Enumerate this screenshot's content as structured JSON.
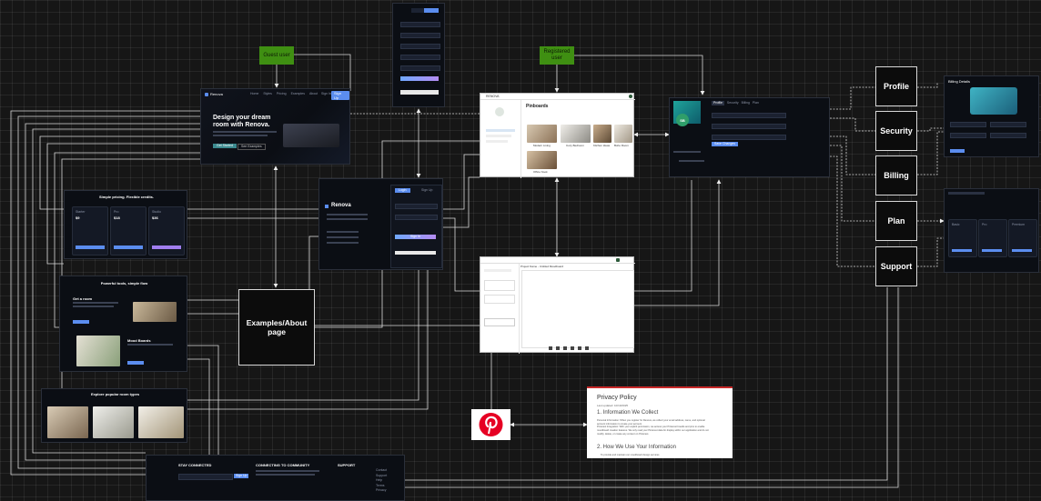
{
  "labels": {
    "guest_user": "Guest user",
    "registered_user": "Registered user",
    "examples_about": "Examples/About page",
    "profile": "Profile",
    "security": "Security",
    "billing": "Billing",
    "plan": "Plan",
    "support": "Support"
  },
  "landing": {
    "brand": "Renova",
    "nav": [
      "Home",
      "Styles",
      "Pricing",
      "Examples",
      "About"
    ],
    "signin": "Sign In",
    "signup": "Sign Up",
    "hero_line1": "Design your dream",
    "hero_line2": "room with Renova.",
    "cta_primary": "Get Started",
    "cta_secondary": "See Examples"
  },
  "auth": {
    "brand": "Renova",
    "tab_login": "Login",
    "tab_signup": "Sign Up",
    "submit": "Sign In"
  },
  "pricing": {
    "title": "Simple pricing. Flexible credits.",
    "plans": [
      {
        "name": "Starter",
        "price": "$9"
      },
      {
        "name": "Pro",
        "price": "$18"
      },
      {
        "name": "Studio",
        "price": "$36"
      }
    ]
  },
  "features": {
    "title": "Powerful tools, simple flow",
    "block1": "Get a room",
    "block2": "Mood Boards"
  },
  "explore": {
    "title": "Explore popular room types"
  },
  "footer": {
    "col1": "STAY CONNECTED",
    "col2": "CONNECTING TO COMMUNITY",
    "col3": "SUPPORT",
    "subscribe": "Sign Up",
    "links": [
      "Contact",
      "Support",
      "Help",
      "Terms",
      "Privacy"
    ]
  },
  "dashboard": {
    "brand": "RENOVA",
    "heading": "Pinboards",
    "items": [
      "Modern Living",
      "Cozy Bedroom",
      "Kitchen Ideas",
      "Boho Room",
      "Office Nook"
    ]
  },
  "editor": {
    "title": "Project Name - Untitled Moodboard"
  },
  "profile_screen": {
    "tabs": [
      "Profile",
      "Security",
      "Billing",
      "Plan"
    ],
    "initials": "SB",
    "save": "Save Changes"
  },
  "billing_screen": {
    "title": "Billing Details"
  },
  "plan_screen": {
    "tiers": [
      "Basic",
      "Pro",
      "Premium"
    ]
  },
  "privacy": {
    "title": "Privacy Policy",
    "updated": "Last updated: 10/10/2025",
    "section1": "1. Information We Collect",
    "para1a": "Personal Information: When you register for Renova, we collect your email address, name, and optional",
    "para1b": "account information to create your account.",
    "para1c": "Pinterest Integration: With your explicit permission, we access your Pinterest boards and pins to enable",
    "para1d": "moodboard creation features. We only read your Pinterest data for display within our application and do not",
    "para1e": "modify, delete, or create any content on Pinterest.",
    "section2": "2. How We Use Your Information",
    "para2a": "To provide and maintain our moodboard design services"
  },
  "colors": {
    "tag_green": "#3f8f12",
    "accent_blue": "#5b8def",
    "pinterest_red": "#e60023",
    "wire": "#e8e8e8"
  }
}
